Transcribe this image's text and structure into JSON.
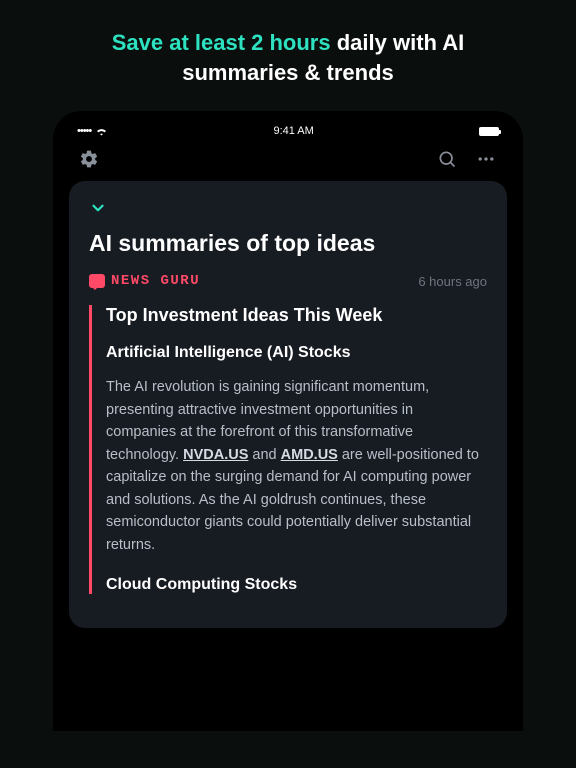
{
  "promo": {
    "highlight": "Save at least 2 hours",
    "rest": " daily with AI summaries  & trends"
  },
  "statusBar": {
    "time": "9:41 AM"
  },
  "card": {
    "title": "AI summaries of top ideas",
    "source": "NEWS GURU",
    "timestamp": "6 hours ago",
    "article": {
      "headline": "Top Investment Ideas This Week",
      "section1_title": "Artificial Intelligence (AI) Stocks",
      "body_pre": "The AI revolution is gaining significant momentum, presenting attractive investment opportunities in companies at the forefront of this transformative technology. ",
      "ticker1": "NVDA.US",
      "body_mid": " and ",
      "ticker2": "AMD.US",
      "body_post": " are well-positioned to capitalize on the surging demand for AI computing power and solutions. As the AI goldrush continues, these semiconductor giants could potentially deliver substantial returns.",
      "section2_title": "Cloud Computing Stocks"
    }
  }
}
